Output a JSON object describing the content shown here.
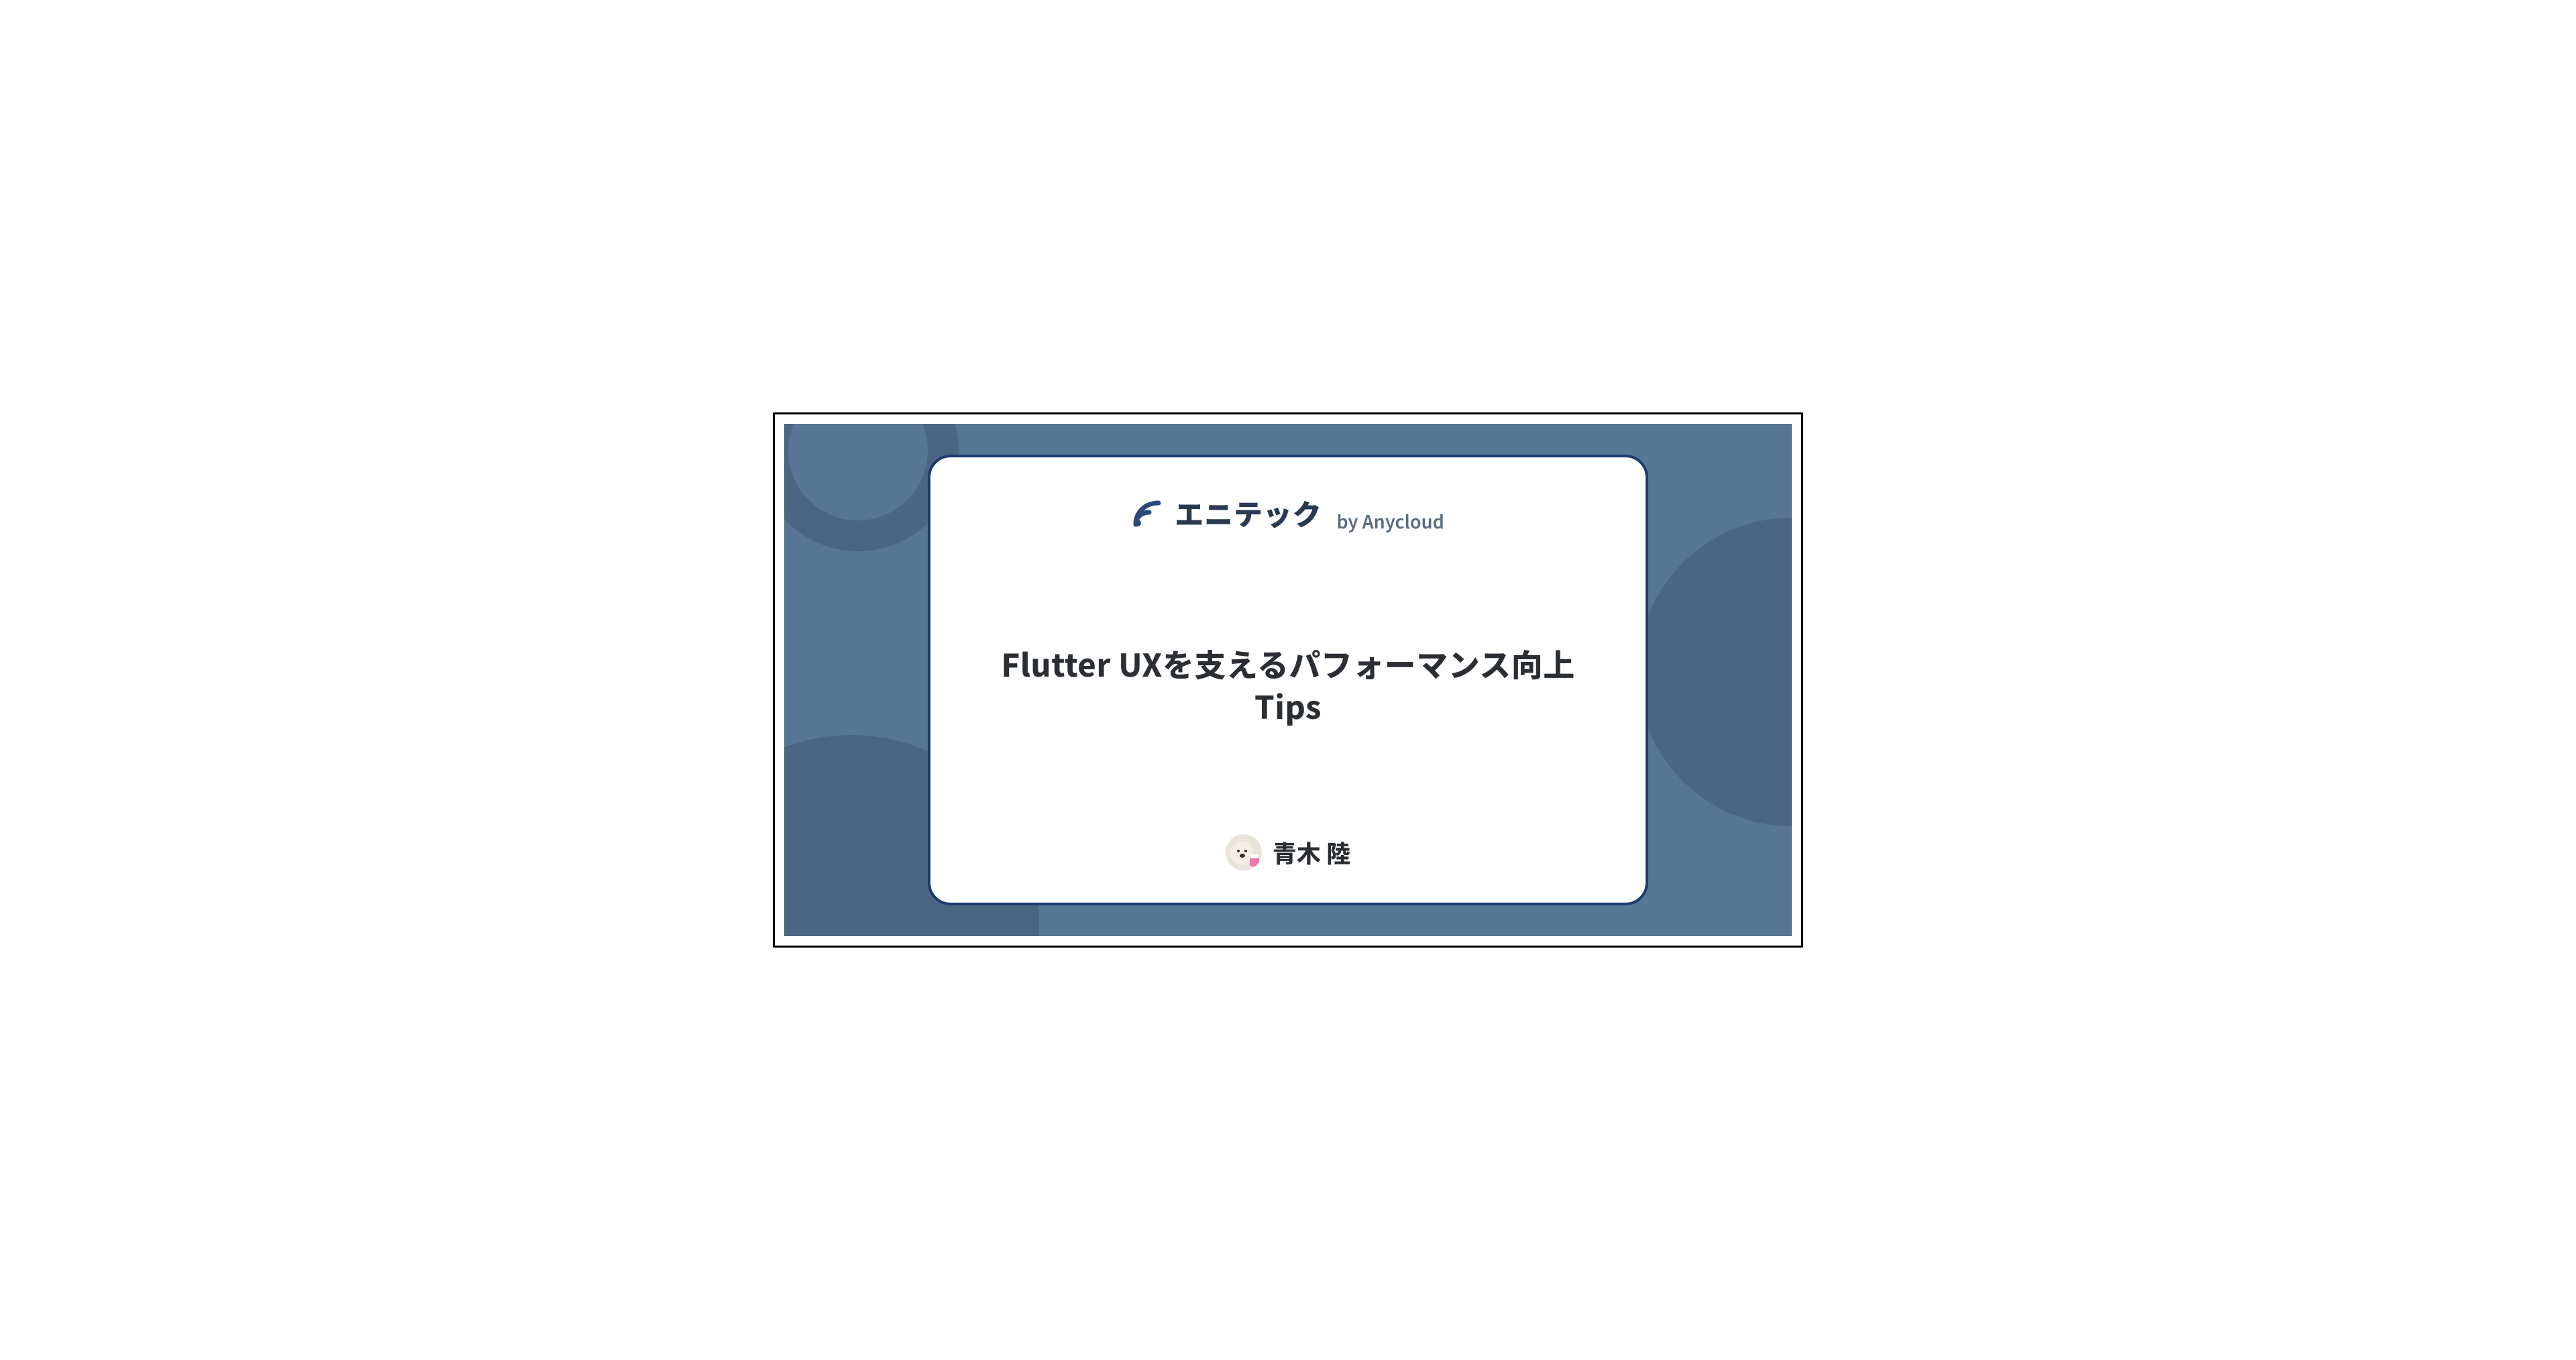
{
  "brand": {
    "name": "エニテック",
    "byline": "by Anycloud"
  },
  "article": {
    "title": "Flutter UXを支えるパフォーマンス向上Tips"
  },
  "author": {
    "name": "青木 陸"
  },
  "colors": {
    "bg": "#577695",
    "shape": "#4a6682",
    "cardBorder": "#1a3a6e",
    "textDark": "#283a52"
  }
}
